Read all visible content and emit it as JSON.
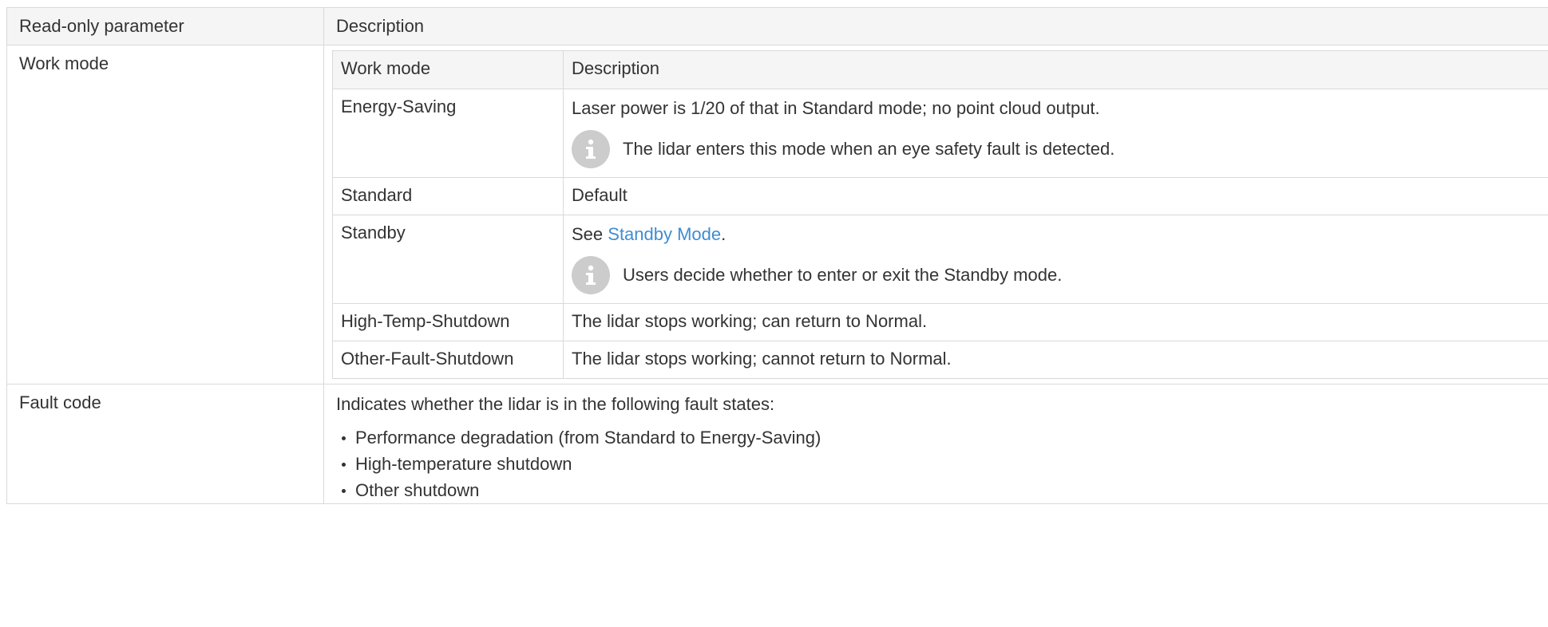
{
  "table": {
    "headers": [
      "Read-only parameter",
      "Description"
    ],
    "work_mode": {
      "param": "Work mode",
      "inner_headers": [
        "Work mode",
        "Description"
      ],
      "rows": {
        "energy_saving": {
          "mode": "Energy-Saving",
          "description": "Laser power is 1/20 of that in Standard mode; no point cloud output.",
          "note": "The lidar enters this mode when an eye safety fault is detected.",
          "note_icon": "info-icon"
        },
        "standard": {
          "mode": "Standard",
          "description": "Default"
        },
        "standby": {
          "mode": "Standby",
          "description_prefix": "See ",
          "link_text": "Standby Mode",
          "description_suffix": ".",
          "note": "Users decide whether to enter or exit the Standby mode.",
          "note_icon": "info-icon"
        },
        "high_temp": {
          "mode": "High-Temp-Shutdown",
          "description": "The lidar stops working; can return to Normal."
        },
        "other_fault": {
          "mode": "Other-Fault-Shutdown",
          "description": "The lidar stops working; cannot return to Normal."
        }
      }
    },
    "fault_code": {
      "param": "Fault code",
      "intro": "Indicates whether the lidar is in the following fault states:",
      "states": [
        "Performance degradation (from Standard to Energy-Saving)",
        "High-temperature shutdown",
        "Other shutdown"
      ]
    }
  },
  "colors": {
    "link": "#3f8dd0",
    "header_bg": "#f5f5f5",
    "border": "#d9d9d9",
    "icon_bg": "#cccccc"
  }
}
